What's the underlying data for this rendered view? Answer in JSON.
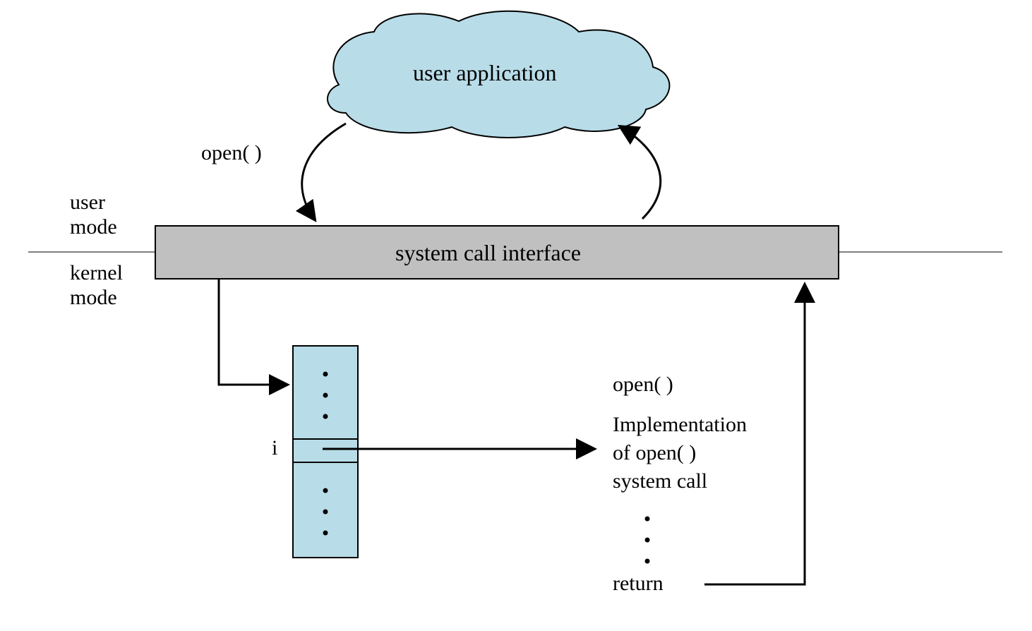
{
  "cloud_label": "user application",
  "call_label": "open( )",
  "mode_user": "user",
  "mode_kernel": "kernel",
  "mode_word": "mode",
  "sci_label": "system call interface",
  "table_index": "i",
  "impl_call": "open( )",
  "impl_line1": "Implementation",
  "impl_line2": "of open( )",
  "impl_line3": "system call",
  "return_label": "return"
}
